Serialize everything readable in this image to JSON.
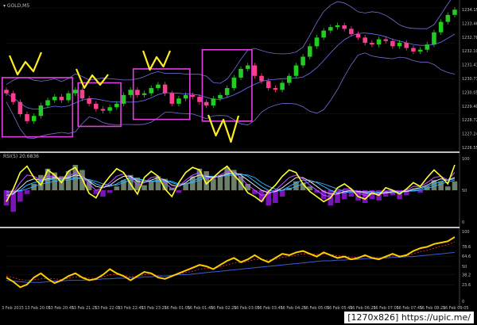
{
  "symbol_label": "▾ GOLD,M5",
  "rsi_label": "RSI(5) 20.6836",
  "watermark": "[1270x826] https://upic.me/",
  "colors": {
    "background": "#000000",
    "bull_candle": "#22cc22",
    "bear_candle": "#ff3d8f",
    "band_upper": "#7b6bd8",
    "band_mid": "#7070ff",
    "box": "#e040e0",
    "arrow": "#ffee22",
    "rsi_line": "#ffff33",
    "ma_cyan": "#33b6ff",
    "ma_white": "#e8e8f0",
    "ma_violet": "#b84dff",
    "histo_pos": "#6b7f6b",
    "histo_neg": "#7a14b8",
    "osc_line": "#ffcc00",
    "osc_slow": "#3b5bd6",
    "osc_dash": "#ff3030",
    "axis_text": "#bfbfbf",
    "separator": "#ffffff"
  },
  "chart_data": [
    {
      "type": "candlestick",
      "title": "GOLD,M5",
      "ylim": [
        1226.5,
        1234.6
      ],
      "ytick_labels": [
        "1234.15",
        "1233.46",
        "1232.78",
        "1232.10",
        "1231.41",
        "1230.73",
        "1230.05",
        "1229.40",
        "1228.72",
        "1227.24",
        "1226.55"
      ],
      "close": [
        1229.7,
        1229.2,
        1228.5,
        1228.1,
        1228.4,
        1229.0,
        1229.3,
        1229.5,
        1229.3,
        1229.7,
        1229.9,
        1229.4,
        1229.1,
        1228.8,
        1228.7,
        1228.9,
        1229.1,
        1229.6,
        1229.9,
        1229.6,
        1229.7,
        1230.0,
        1230.2,
        1229.7,
        1229.1,
        1229.4,
        1229.6,
        1229.5,
        1229.2,
        1229.0,
        1229.4,
        1229.6,
        1230.0,
        1230.6,
        1231.1,
        1231.3,
        1230.7,
        1230.4,
        1230.0,
        1229.9,
        1230.3,
        1230.7,
        1231.3,
        1231.8,
        1232.4,
        1232.9,
        1233.3,
        1233.5,
        1233.6,
        1233.4,
        1233.1,
        1232.9,
        1232.6,
        1232.5,
        1232.8,
        1232.7,
        1232.4,
        1232.6,
        1232.3,
        1232.1,
        1232.2,
        1232.5,
        1233.2,
        1233.8,
        1234.2,
        1234.5
      ],
      "annotations": [
        "magenta boxes",
        "yellow arrows"
      ]
    },
    {
      "type": "line",
      "title": "RSI(5) 20.6836",
      "ylim": [
        0,
        100
      ],
      "ytick_labels": [
        "100",
        "50",
        "0"
      ],
      "series": [
        {
          "values": [
            32,
            52,
            78,
            88,
            70,
            58,
            82,
            74,
            62,
            80,
            86,
            68,
            45,
            38,
            58,
            72,
            84,
            78,
            60,
            44,
            70,
            80,
            72,
            52,
            40,
            62,
            78,
            86,
            82,
            60,
            70,
            80,
            88,
            74,
            62,
            46,
            40,
            32,
            48,
            58,
            72,
            82,
            78,
            60,
            48,
            40,
            32,
            38,
            54,
            60,
            52,
            40,
            36,
            46,
            42,
            54,
            50,
            44,
            52,
            62,
            56,
            70,
            82,
            72,
            60,
            90
          ]
        },
        {
          "values": [
            38,
            46,
            62,
            74,
            72,
            66,
            72,
            72,
            68,
            72,
            78,
            72,
            60,
            50,
            54,
            62,
            72,
            76,
            70,
            58,
            62,
            70,
            72,
            62,
            52,
            56,
            66,
            74,
            78,
            70,
            68,
            74,
            80,
            78,
            70,
            58,
            50,
            42,
            44,
            50,
            60,
            70,
            74,
            68,
            58,
            50,
            42,
            40,
            46,
            52,
            52,
            46,
            42,
            44,
            44,
            48,
            50,
            48,
            50,
            56,
            56,
            62,
            70,
            72,
            66,
            78
          ]
        },
        {
          "values": [
            42,
            44,
            54,
            64,
            68,
            66,
            68,
            70,
            68,
            70,
            74,
            72,
            64,
            56,
            54,
            58,
            66,
            72,
            72,
            64,
            62,
            66,
            70,
            66,
            58,
            56,
            62,
            70,
            74,
            72,
            70,
            72,
            76,
            78,
            74,
            66,
            58,
            50,
            46,
            48,
            54,
            62,
            70,
            70,
            64,
            56,
            48,
            44,
            44,
            48,
            50,
            48,
            46,
            44,
            44,
            46,
            48,
            48,
            48,
            52,
            54,
            58,
            64,
            68,
            66,
            70
          ]
        },
        {
          "values": [
            46,
            46,
            50,
            58,
            62,
            64,
            66,
            68,
            68,
            68,
            70,
            70,
            66,
            60,
            56,
            56,
            60,
            66,
            70,
            68,
            64,
            64,
            66,
            66,
            62,
            58,
            60,
            64,
            70,
            72,
            72,
            72,
            74,
            76,
            76,
            72,
            64,
            56,
            50,
            48,
            50,
            56,
            62,
            66,
            66,
            62,
            56,
            50,
            46,
            46,
            48,
            48,
            48,
            46,
            46,
            46,
            46,
            48,
            48,
            50,
            52,
            56,
            60,
            64,
            66,
            68
          ]
        },
        {
          "values": [
            48,
            48,
            49,
            52,
            56,
            60,
            62,
            64,
            66,
            66,
            68,
            68,
            67,
            64,
            60,
            58,
            58,
            62,
            66,
            68,
            66,
            64,
            64,
            65,
            64,
            60,
            60,
            62,
            66,
            70,
            71,
            72,
            73,
            74,
            75,
            74,
            70,
            62,
            56,
            52,
            50,
            52,
            56,
            60,
            63,
            63,
            60,
            56,
            52,
            48,
            47,
            48,
            48,
            48,
            47,
            47,
            46,
            47,
            48,
            49,
            50,
            53,
            56,
            60,
            63,
            66
          ]
        }
      ],
      "histogram": [
        -24,
        -34,
        -18,
        -6,
        10,
        24,
        34,
        28,
        22,
        30,
        40,
        32,
        14,
        -6,
        -10,
        -4,
        6,
        16,
        24,
        20,
        8,
        14,
        22,
        18,
        4,
        -4,
        10,
        22,
        34,
        30,
        18,
        24,
        36,
        32,
        22,
        10,
        -6,
        -18,
        -24,
        -20,
        -10,
        4,
        14,
        12,
        6,
        -4,
        -14,
        -24,
        -20,
        -14,
        -10,
        -16,
        -20,
        -14,
        -16,
        -10,
        -8,
        -14,
        -8,
        -2,
        -4,
        6,
        16,
        14,
        6,
        14
      ],
      "histogram_range": [
        -50,
        50
      ]
    },
    {
      "type": "line",
      "ylim": [
        0,
        100
      ],
      "ytick_labels": [
        "100",
        "78.6",
        "64.6",
        "50",
        "38.2",
        "23.6",
        "0"
      ],
      "x_tick_labels": [
        "3 Feb 2015",
        "13 Feb 20:05",
        "13 Feb 20:45",
        "13 Feb 21:25",
        "13 Feb 22:05",
        "13 Feb 22:45",
        "13 Feb 23:25",
        "16 Feb 01:05",
        "16 Feb 01:45",
        "16 Feb 02:25",
        "16 Feb 03:05",
        "16 Feb 03:45",
        "16 Feb 04:25",
        "16 Feb 05:05",
        "16 Feb 05:45",
        "16 Feb 06:25",
        "16 Feb 07:05",
        "16 Feb 07:45",
        "16 Feb 08:25",
        "16 Feb 09:05"
      ],
      "series": [
        {
          "values": [
            34,
            28,
            20,
            24,
            34,
            40,
            32,
            26,
            30,
            36,
            40,
            34,
            30,
            32,
            38,
            46,
            40,
            36,
            30,
            36,
            42,
            40,
            34,
            32,
            36,
            40,
            44,
            48,
            52,
            50,
            46,
            52,
            58,
            62,
            56,
            60,
            66,
            60,
            56,
            62,
            68,
            66,
            70,
            72,
            68,
            64,
            70,
            66,
            62,
            64,
            60,
            62,
            66,
            62,
            60,
            64,
            68,
            64,
            66,
            72,
            76,
            78,
            82,
            84,
            86,
            92
          ]
        },
        {
          "values": [
            30,
            29,
            28,
            27,
            27,
            27,
            28,
            29,
            29,
            30,
            30,
            30,
            31,
            31,
            32,
            32,
            33,
            33,
            34,
            34,
            35,
            35,
            36,
            36,
            37,
            38,
            38,
            39,
            40,
            41,
            42,
            43,
            44,
            45,
            46,
            47,
            48,
            49,
            50,
            51,
            52,
            53,
            54,
            55,
            56,
            57,
            58,
            58,
            59,
            59,
            60,
            60,
            61,
            61,
            62,
            62,
            63,
            63,
            64,
            64,
            65,
            66,
            67,
            68,
            69,
            70
          ]
        },
        {
          "values": [
            36,
            34,
            31,
            30,
            31,
            32,
            33,
            32,
            31,
            33,
            35,
            34,
            33,
            33,
            35,
            38,
            38,
            37,
            35,
            36,
            38,
            39,
            37,
            36,
            37,
            39,
            41,
            43,
            46,
            47,
            47,
            49,
            52,
            55,
            55,
            57,
            60,
            60,
            59,
            60,
            63,
            64,
            66,
            68,
            68,
            67,
            68,
            67,
            65,
            65,
            63,
            63,
            64,
            63,
            62,
            63,
            65,
            65,
            65,
            68,
            71,
            73,
            76,
            79,
            81,
            85
          ]
        }
      ]
    }
  ]
}
